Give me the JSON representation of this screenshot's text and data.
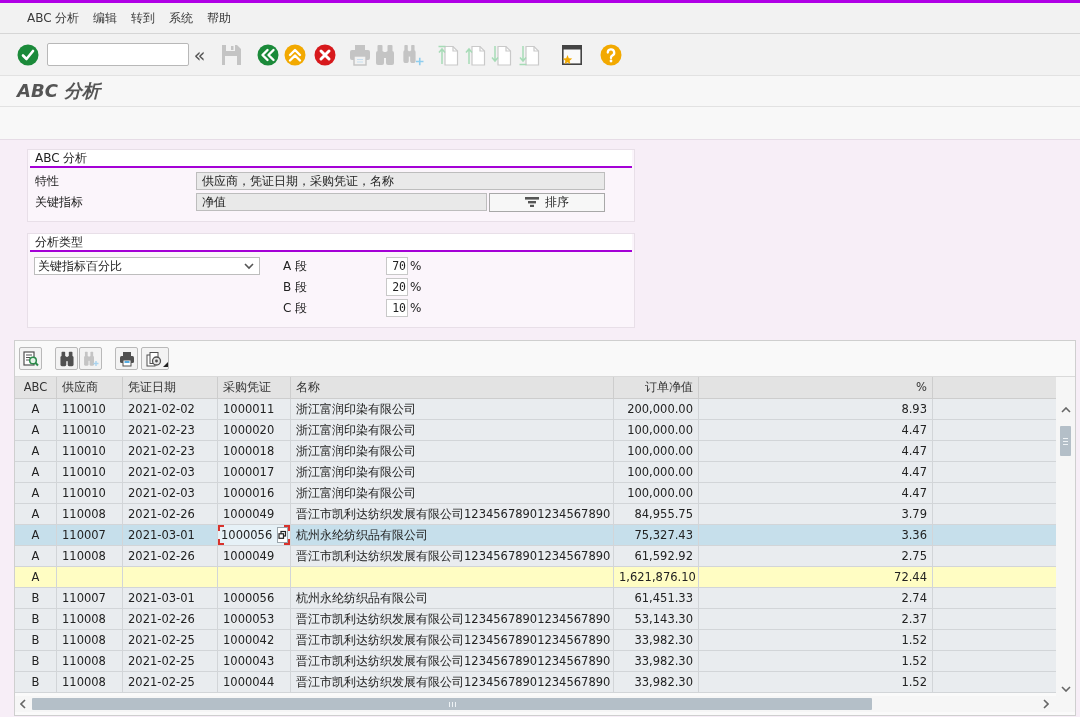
{
  "menu_bar": {
    "items": [
      "ABC 分析",
      "编辑",
      "转到",
      "系统",
      "帮助"
    ]
  },
  "toolbar": {
    "items": [
      {
        "kind": "enter",
        "disabled": false
      },
      {
        "kind": "command_field",
        "disabled": false
      },
      {
        "kind": "collapse",
        "label": "«",
        "disabled": false
      },
      {
        "kind": "save",
        "disabled": true
      },
      {
        "kind": "back",
        "disabled": false
      },
      {
        "kind": "exit",
        "disabled": false
      },
      {
        "kind": "cancel",
        "disabled": false
      },
      {
        "kind": "print",
        "disabled": true
      },
      {
        "kind": "find",
        "disabled": true
      },
      {
        "kind": "find_next",
        "disabled": true
      },
      {
        "kind": "first_page",
        "disabled": true
      },
      {
        "kind": "previous_page",
        "disabled": true
      },
      {
        "kind": "next_page",
        "disabled": true
      },
      {
        "kind": "last_page",
        "disabled": true
      },
      {
        "kind": "layout",
        "disabled": false
      },
      {
        "kind": "help",
        "disabled": false
      }
    ]
  },
  "title": "ABC 分析",
  "criteria": {
    "title": "ABC 分析",
    "fields": [
      {
        "label": "特性",
        "value": "供应商，凭证日期，采购凭证，名称"
      },
      {
        "label": "关键指标",
        "value": "净值"
      }
    ],
    "sort_button": {
      "label": "排序"
    }
  },
  "analysis_type": {
    "title": "分析类型",
    "dropdown": {
      "value": "关键指标百分比"
    },
    "segments": [
      {
        "label": "A 段",
        "value": "70",
        "unit": "%"
      },
      {
        "label": "B 段",
        "value": "20",
        "unit": "%"
      },
      {
        "label": "C 段",
        "value": "10",
        "unit": "%"
      }
    ]
  },
  "grid": {
    "toolbar": [
      {
        "kind": "details",
        "disabled": false
      },
      {
        "kind": "find",
        "disabled": false
      },
      {
        "kind": "find_next",
        "disabled": true
      },
      {
        "kind": "print",
        "disabled": false
      },
      {
        "kind": "views",
        "disabled": false
      }
    ],
    "columns": [
      {
        "label": "ABC",
        "kind": "code",
        "cursor": false
      },
      {
        "label": "供应商",
        "kind": "text",
        "cursor": false
      },
      {
        "label": "凭证日期",
        "kind": "text",
        "cursor": false
      },
      {
        "label": "采购凭证",
        "kind": "text",
        "cursor": true
      },
      {
        "label": "名称",
        "kind": "text",
        "cursor": false
      },
      {
        "label": "订单净值",
        "kind": "amount",
        "cursor": false
      },
      {
        "label": "%",
        "kind": "amount",
        "cursor": false
      }
    ],
    "rows": [
      {
        "kind": "item",
        "selected": false,
        "cells": [
          "A",
          "110010",
          "2021-02-02",
          "1000011",
          "浙江富润印染有限公司",
          "200,000.00",
          "8.93"
        ]
      },
      {
        "kind": "item",
        "selected": false,
        "cells": [
          "A",
          "110010",
          "2021-02-23",
          "1000020",
          "浙江富润印染有限公司",
          "100,000.00",
          "4.47"
        ]
      },
      {
        "kind": "item",
        "selected": false,
        "cells": [
          "A",
          "110010",
          "2021-02-23",
          "1000018",
          "浙江富润印染有限公司",
          "100,000.00",
          "4.47"
        ]
      },
      {
        "kind": "item",
        "selected": false,
        "cells": [
          "A",
          "110010",
          "2021-02-03",
          "1000017",
          "浙江富润印染有限公司",
          "100,000.00",
          "4.47"
        ]
      },
      {
        "kind": "item",
        "selected": false,
        "cells": [
          "A",
          "110010",
          "2021-02-03",
          "1000016",
          "浙江富润印染有限公司",
          "100,000.00",
          "4.47"
        ]
      },
      {
        "kind": "item",
        "selected": false,
        "cells": [
          "A",
          "110008",
          "2021-02-26",
          "1000049",
          "晋江市凯利达纺织发展有限公司12345678901234567890",
          "84,955.75",
          "3.79"
        ]
      },
      {
        "kind": "item",
        "selected": true,
        "cells": [
          "A",
          "110007",
          "2021-03-01",
          "1000056",
          "杭州永纶纺织品有限公司",
          "75,327.43",
          "3.36"
        ]
      },
      {
        "kind": "item",
        "selected": false,
        "cells": [
          "A",
          "110008",
          "2021-02-26",
          "1000049",
          "晋江市凯利达纺织发展有限公司12345678901234567890",
          "61,592.92",
          "2.75"
        ]
      },
      {
        "kind": "subtotal",
        "selected": false,
        "cells": [
          "A",
          null,
          null,
          null,
          null,
          "1,621,876.10",
          "72.44"
        ]
      },
      {
        "kind": "item",
        "selected": false,
        "cells": [
          "B",
          "110007",
          "2021-03-01",
          "1000056",
          "杭州永纶纺织品有限公司",
          "61,451.33",
          "2.74"
        ]
      },
      {
        "kind": "item",
        "selected": false,
        "cells": [
          "B",
          "110008",
          "2021-02-26",
          "1000053",
          "晋江市凯利达纺织发展有限公司12345678901234567890",
          "53,143.30",
          "2.37"
        ]
      },
      {
        "kind": "item",
        "selected": false,
        "cells": [
          "B",
          "110008",
          "2021-02-25",
          "1000042",
          "晋江市凯利达纺织发展有限公司12345678901234567890",
          "33,982.30",
          "1.52"
        ]
      },
      {
        "kind": "item",
        "selected": false,
        "cells": [
          "B",
          "110008",
          "2021-02-25",
          "1000043",
          "晋江市凯利达纺织发展有限公司12345678901234567890",
          "33,982.30",
          "1.52"
        ]
      },
      {
        "kind": "item",
        "selected": false,
        "cells": [
          "B",
          "110008",
          "2021-02-25",
          "1000044",
          "晋江市凯利达纺织发展有限公司12345678901234567890",
          "33,982.30",
          "1.52"
        ]
      }
    ]
  }
}
